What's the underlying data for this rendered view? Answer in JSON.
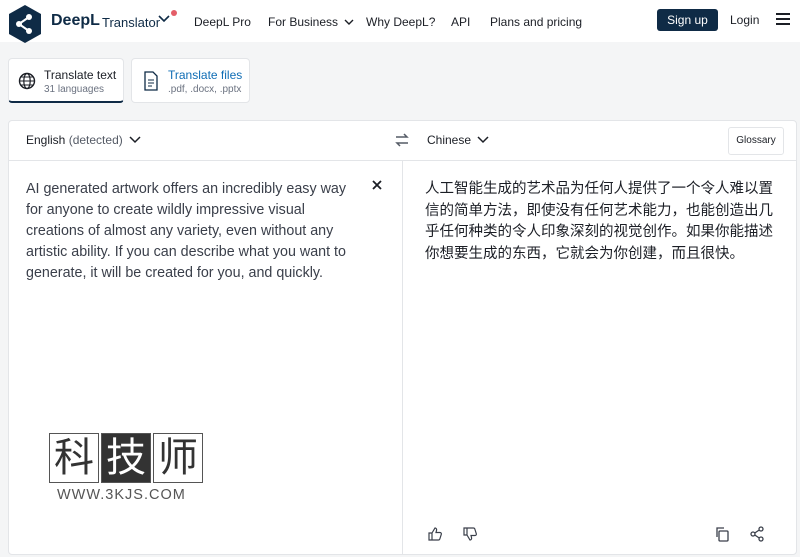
{
  "header": {
    "brand": "DeepL",
    "brand_sub": "Translator",
    "nav": [
      "DeepL Pro",
      "For Business",
      "Why DeepL?",
      "API",
      "Plans and pricing"
    ],
    "signup": "Sign up",
    "login": "Login"
  },
  "tabs": [
    {
      "title": "Translate text",
      "subtitle": "31 languages"
    },
    {
      "title": "Translate files",
      "subtitle": ".pdf, .docx, .pptx"
    }
  ],
  "translator": {
    "source_lang": "English",
    "source_detected": "(detected)",
    "target_lang": "Chinese",
    "glossary": "Glossary",
    "source_text": "AI generated artwork offers an incredibly easy way for anyone to create wildly impressive visual creations of almost any variety, even without any artistic ability. If you can describe what you want to generate, it will be created for you, and quickly.",
    "target_text": "人工智能生成的艺术品为任何人提供了一个令人难以置信的简单方法，即使没有任何艺术能力，也能创造出几乎任何种类的令人印象深刻的视觉创作。如果你能描述你想要生成的东西，它就会为你创建，而且很快。"
  },
  "watermark": {
    "chars": [
      "科",
      "技",
      "师"
    ],
    "url": "WWW.3KJS.COM"
  },
  "colors": {
    "brand": "#0f2b46",
    "accent_dot": "#e45e68"
  }
}
